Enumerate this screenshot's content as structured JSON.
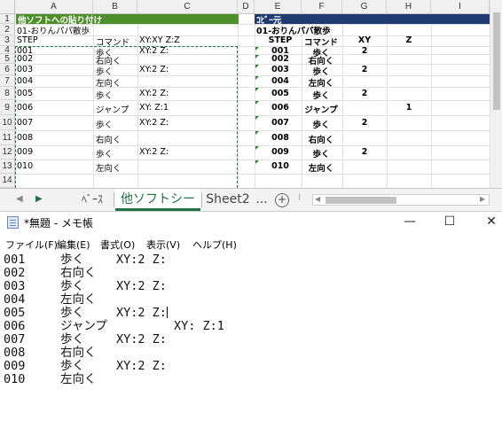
{
  "excel": {
    "columns": [
      "A",
      "B",
      "C",
      "D",
      "E",
      "F",
      "G",
      "H",
      "I"
    ],
    "rows": [
      "1",
      "2",
      "3",
      "4",
      "5",
      "6",
      "7",
      "8",
      "9",
      "10",
      "11",
      "12",
      "13",
      "14"
    ],
    "left_block": {
      "header": "他ソフトへの貼り付け",
      "title": "01-おりんパパ散歩",
      "col_headers": [
        "STEP",
        "コマンド",
        "XY:XY Z:Z"
      ],
      "rows": [
        {
          "step": "001",
          "cmd": "歩く",
          "xyz": "XY:2 Z:"
        },
        {
          "step": "002",
          "cmd": "右向く",
          "xyz": ""
        },
        {
          "step": "003",
          "cmd": "歩く",
          "xyz": "XY:2 Z:"
        },
        {
          "step": "004",
          "cmd": "左向く",
          "xyz": ""
        },
        {
          "step": "005",
          "cmd": "歩く",
          "xyz": "XY:2 Z:"
        },
        {
          "step": "006",
          "cmd": "ジャンプ",
          "xyz": "XY: Z:1"
        },
        {
          "step": "007",
          "cmd": "歩く",
          "xyz": "XY:2 Z:"
        },
        {
          "step": "008",
          "cmd": "右向く",
          "xyz": ""
        },
        {
          "step": "009",
          "cmd": "歩く",
          "xyz": "XY:2 Z:"
        },
        {
          "step": "010",
          "cmd": "左向く",
          "xyz": ""
        }
      ]
    },
    "right_block": {
      "header": "ｺﾋﾟｰ元",
      "title": "01-おりんパパ散歩",
      "col_headers": [
        "STEP",
        "コマンド",
        "XY",
        "Z"
      ],
      "rows": [
        {
          "step": "001",
          "cmd": "歩く",
          "xy": "2",
          "z": ""
        },
        {
          "step": "002",
          "cmd": "右向く",
          "xy": "",
          "z": ""
        },
        {
          "step": "003",
          "cmd": "歩く",
          "xy": "2",
          "z": ""
        },
        {
          "step": "004",
          "cmd": "左向く",
          "xy": "",
          "z": ""
        },
        {
          "step": "005",
          "cmd": "歩く",
          "xy": "2",
          "z": ""
        },
        {
          "step": "006",
          "cmd": "ジャンプ",
          "xy": "",
          "z": "1"
        },
        {
          "step": "007",
          "cmd": "歩く",
          "xy": "2",
          "z": ""
        },
        {
          "step": "008",
          "cmd": "右向く",
          "xy": "",
          "z": ""
        },
        {
          "step": "009",
          "cmd": "歩く",
          "xy": "2",
          "z": ""
        },
        {
          "step": "010",
          "cmd": "左向く",
          "xy": "",
          "z": ""
        }
      ]
    },
    "tabs": {
      "ellipsis_left": "...",
      "prev_icon": "◀",
      "next_icon": "▶",
      "items": [
        "ﾍﾞｰｽ",
        "他ソフトシート",
        "Sheet2"
      ],
      "active": "他ソフトシート",
      "ellipsis_right": "...",
      "add_label": "+",
      "menu_dots": "⁝"
    },
    "colors": {
      "green_header": "#4e8f2c",
      "navy_header": "#1f3a6e",
      "active_tab": "#217346"
    }
  },
  "notepad": {
    "title": "*無題 - メモ帳",
    "window_buttons": {
      "minimize": "—",
      "maximize": "☐",
      "close": "✕"
    },
    "menu": [
      "ファイル(F)",
      "編集(E)",
      "書式(O)",
      "表示(V)",
      "ヘルプ(H)"
    ],
    "lines": [
      "001\t歩く\tXY:2 Z:",
      "002\t右向く",
      "003\t歩く\tXY:2 Z:",
      "004\t左向く",
      "005\t歩く\tXY:2 Z:",
      "006\tジャンプ\tXY: Z:1",
      "007\t歩く\tXY:2 Z:",
      "008\t右向く",
      "009\t歩く\tXY:2 Z:",
      "010\t左向く"
    ]
  }
}
